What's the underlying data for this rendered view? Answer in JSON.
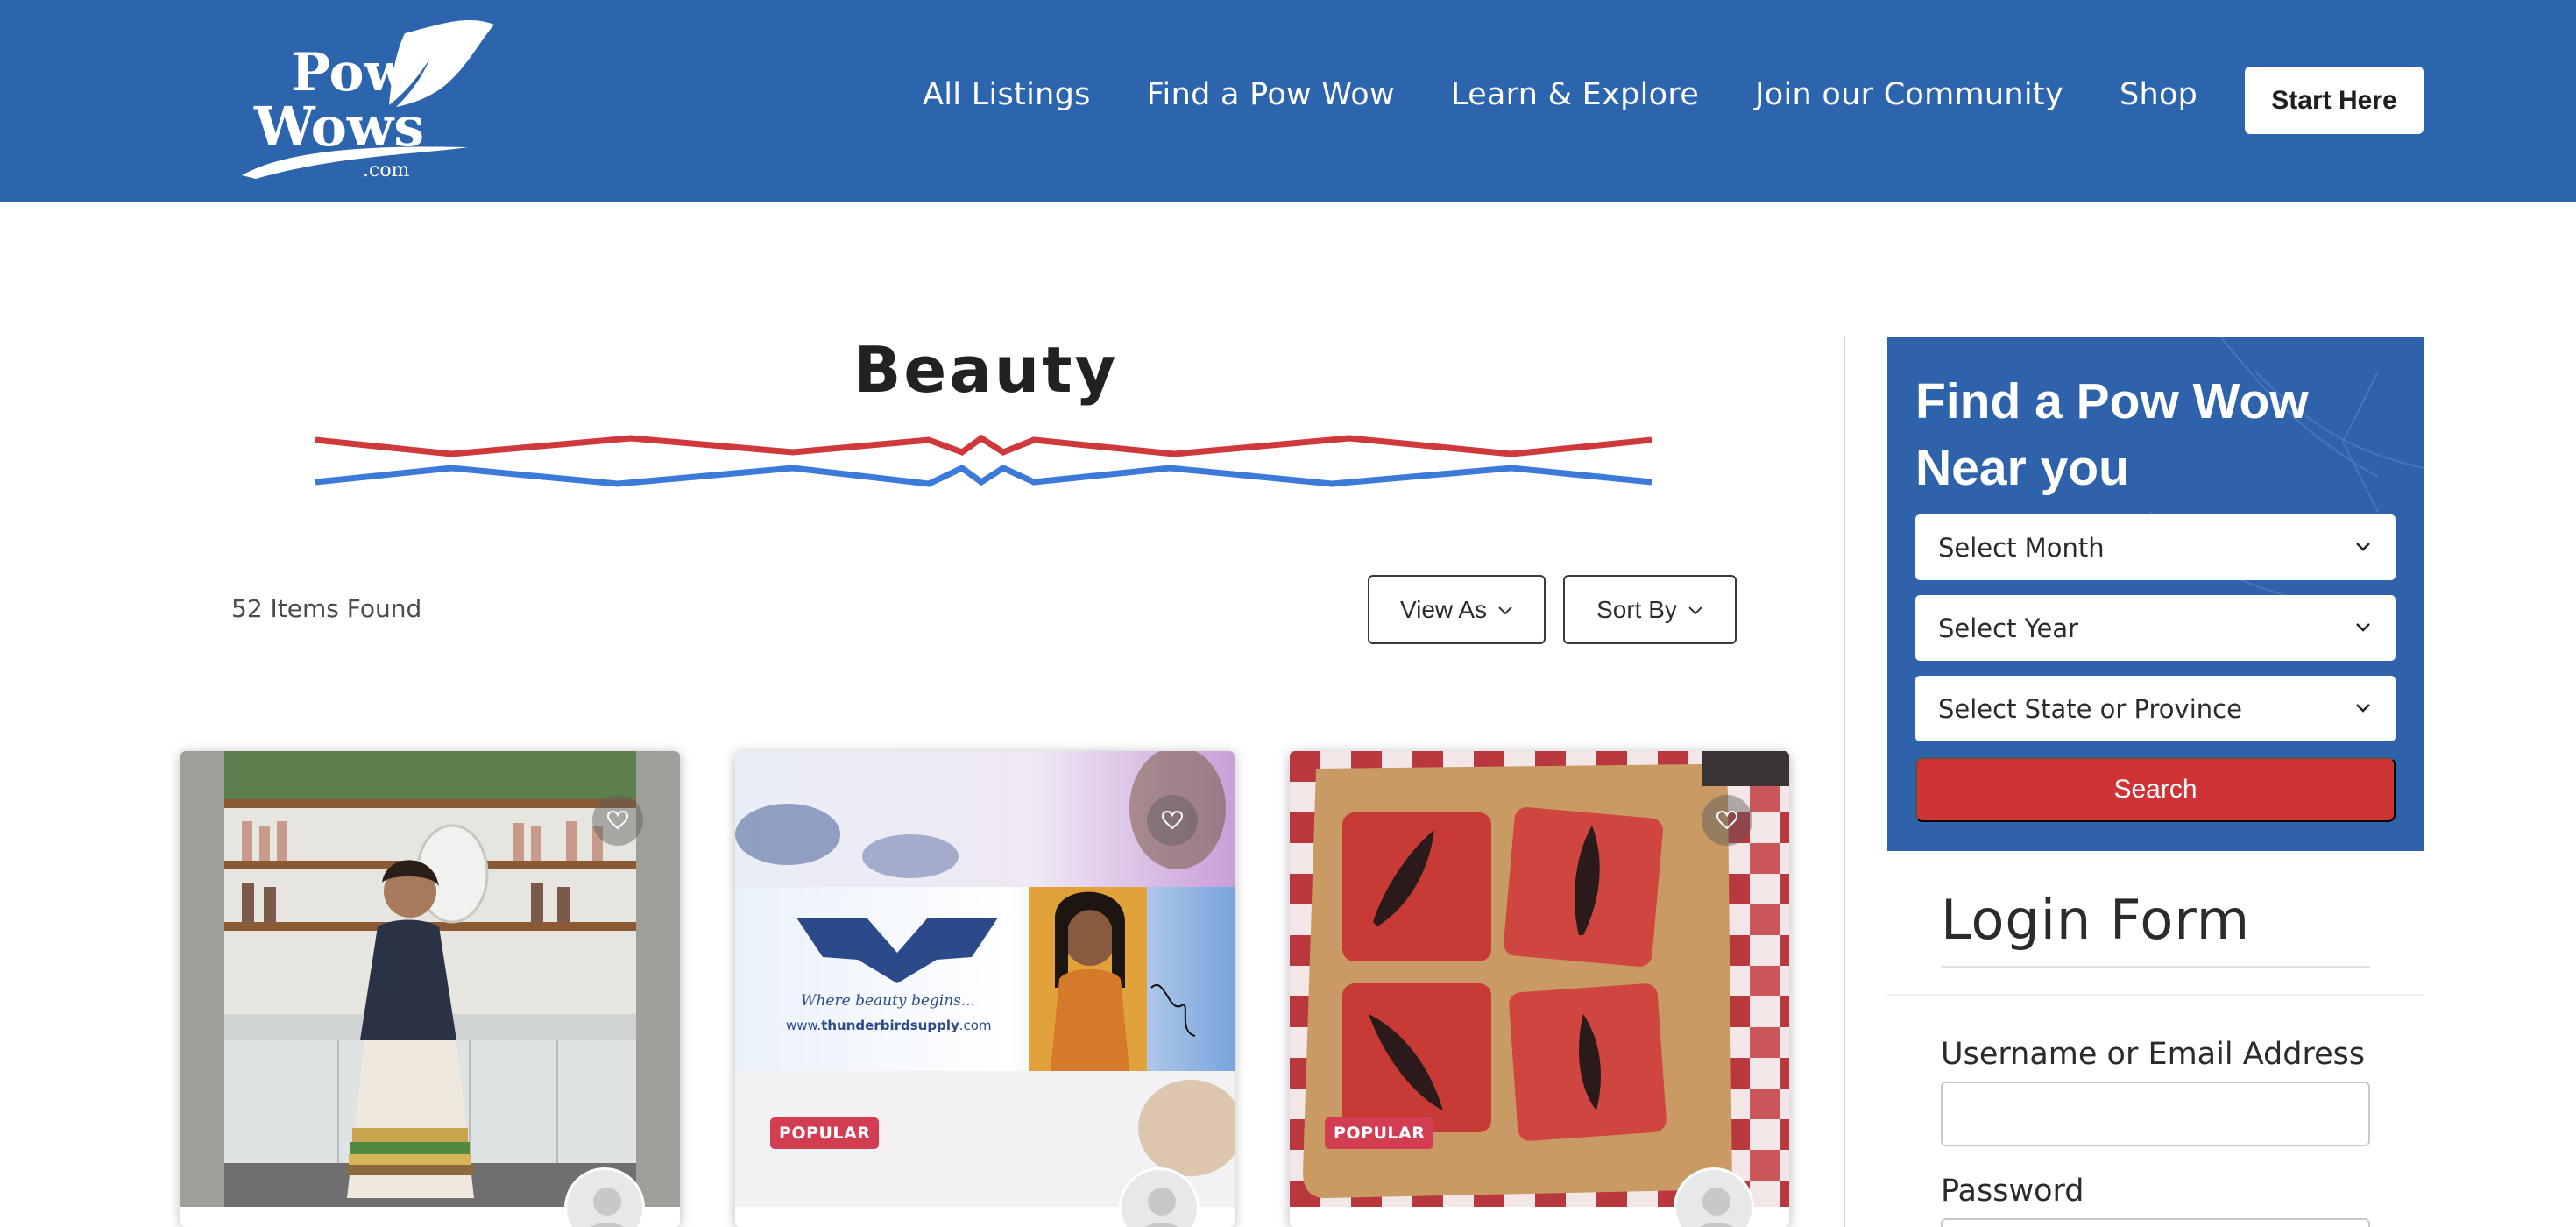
{
  "header": {
    "logo_text": "Pow Wows .com",
    "nav": [
      "All Listings",
      "Find a Pow Wow",
      "Learn & Explore",
      "Join our Community",
      "Shop"
    ],
    "cta": "Start Here"
  },
  "main": {
    "title": "Beauty",
    "items_found": "52 Items Found",
    "view_as": "View As",
    "sort_by": "Sort By",
    "cards": [
      {
        "badge": "",
        "image": "woman-in-makeup-store"
      },
      {
        "badge": "POPULAR",
        "image": "thunderbird-supply-banner",
        "banner_tagline": "Where beauty begins...",
        "banner_url_prefix": "www.",
        "banner_url_domain": "thunderbirdsupply",
        "banner_url_suffix": ".com"
      },
      {
        "badge": "POPULAR",
        "image": "red-feather-soaps"
      }
    ]
  },
  "sidebar": {
    "widget_title": "Find a Pow Wow Near you",
    "month_select": "Select Month",
    "year_select": "Select Year",
    "state_select": "Select State or Province",
    "search_button": "Search",
    "login_title": "Login Form",
    "username_label": "Username or Email Address",
    "password_label": "Password"
  },
  "colors": {
    "header_bg": "#2c64ae",
    "red_line": "#d0393b",
    "blue_line": "#3b7ad8",
    "badge": "#d33d52",
    "search_button": "#d03336"
  }
}
